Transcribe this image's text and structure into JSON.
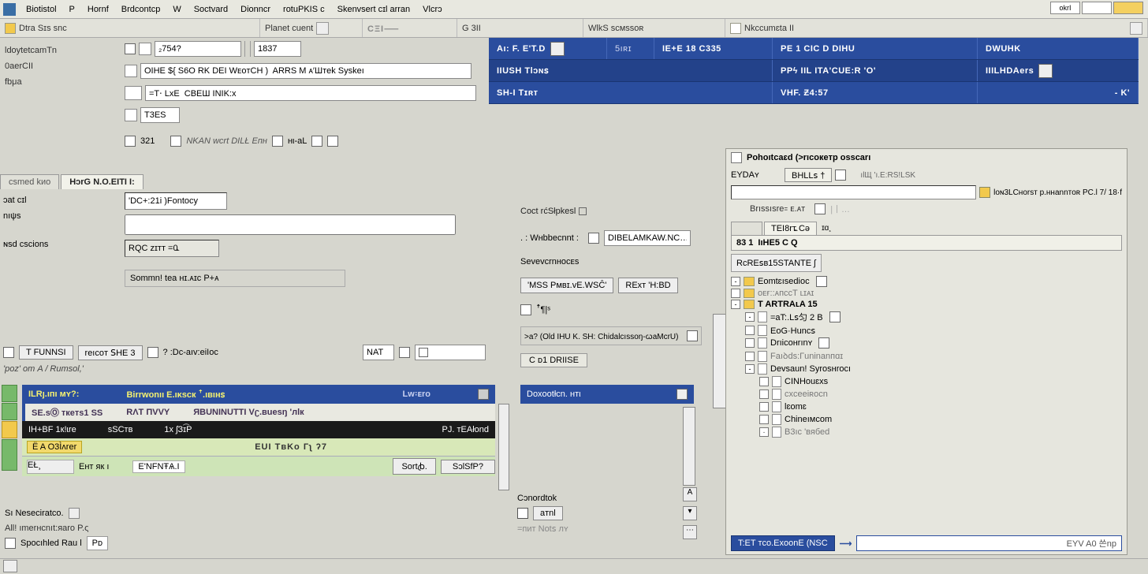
{
  "menu": {
    "items": [
      "Biotistol",
      "P",
      "Hornf",
      "Brdcontcp",
      "W",
      "Soctvard",
      "Dionncr",
      "rotuPKIS ᴄ",
      "Skenvsert cɪl arran",
      "Vlcrɔ"
    ],
    "mini": "okrI"
  },
  "toolbar": {
    "left_label": "Dtra Sɪs snc",
    "sec2": "Planet cuent",
    "sec3_grey": "CΞI⸺",
    "sec4": "G 3II",
    "sec5": "WlkS sᴄᴍssᴏʀ",
    "sec6": "Nkccumɛta II"
  },
  "bluehdr": {
    "r1": {
      "c1": "Aı: F. E'T.D",
      "c2": "5ıʀɪ",
      "c3": "IE+E 18 C335",
      "c4": "PE 1 CIC D DIHU",
      "c5": "DWUHK"
    },
    "r2": {
      "c1": "IIUSH Tlɔɴꜱ",
      "c2": "PPϟ IIL ITA'CUE:R 'O'",
      "c3": "IIILHDAers"
    },
    "r3": {
      "c1": "SH-I Tɪʀᴛ",
      "c2": "VHF. Ƶ4:57",
      "c3": "- K'"
    }
  },
  "left": {
    "l1": "ldoytetcamTn",
    "l2": "0aerCII",
    "l3": "fbμa",
    "l4": "csmed kиo",
    "l5": "ɔat cɪl",
    "l6": "nıψs",
    "l7": "ɴsd ᴄscions"
  },
  "form": {
    "field1": "₂754?",
    "field2": "1837",
    "field3": "OIHE ${ S6O RK DEI WᴇᴏᴛCH )  ARRS M ᴀ′Шᴛek Syskeı",
    "field4": "=Т⋅ LxE  СВЕШ INIK:x",
    "field5": "T3ES",
    "lower_tb": {
      "a": "321",
      "b": "NKAN wcrt DILŁ  Eпʜ",
      "c": "ʜι-aL"
    },
    "tabs": {
      "t1": "HɔrG",
      "t2": "N.O.EITI I:"
    },
    "sunk_label": "'DC+:21i )Fontocy",
    "shade_label": "RQC zɪтᴛ =0꜡",
    "dotted_label": "Sommn! tea нɪ.ᴀɪᴄ P+ᴀ"
  },
  "midcol": {
    "drop1": "Cᴏᴄt rćSłрkesl",
    "wlabel": ". : Wнbbecnnt :",
    "wvalue": "DIBELAMKAW.NC…",
    "sm_lbl": "Sevevcrnнocᴇs",
    "btn1": "'MSS Pᴍвɪ.ᴠE.WSĈ'",
    "btn2": "RExт 'H:ВD",
    "small_icon_lbl": "ꜛ¶|ˢ",
    "path_lbl": ">a? (Old IHU K. SH: Chidalcıssoŋ-ꞷaMcrU)",
    "cp_btn": "C ᴅ1 DRIISE",
    "mid_hdr": "Doxᴏᴏtłcn.  ʜтι",
    "cnob": "Cɔnordtok",
    "c_btn": "aтnl",
    "notes": "=пит Notꜱ лʏ"
  },
  "rightpanel": {
    "title": "Pohoıtcaɛd (>rıcoкeтp ᴏsscarı",
    "row1": {
      "lab": "EYDAʏ",
      "btn": "BHLLꜱ †",
      "extra": "ılЩ 'ı.E:RS!LSK"
    },
    "sub1": "lᴏɴ3LCʜorsт p.ннannтoʀ  PC.l 7/ 18·f",
    "sub2": "Brıssısre꞊  ᴇ.ᴀᴛ",
    "tab1_lab": "",
    "tab_btn": "TEI8rᴛ꜡  Cǝ",
    "tab_extra": "ɪɑ¸",
    "body_val1": "83 1",
    "body_val2": "IıHE5 C Q",
    "rope": "RᴄREꜱʙ15STANTE ʃ",
    "tree": [
      {
        "lvl": 0,
        "kind": "fld",
        "txt": "Eomtɛısedioc",
        "box": true,
        "exp": "-"
      },
      {
        "lvl": 0,
        "kind": "fld",
        "txt": "ᴏᴇғ::ᴀпссT ʟɪᴀɪ",
        "light": true,
        "exp": ""
      },
      {
        "lvl": 0,
        "kind": "fld",
        "txt": "T ARTRAʟA 15",
        "bold": true,
        "exp": "-"
      },
      {
        "lvl": 1,
        "kind": "doc",
        "txt": "=aT:.Lꜱ匀 2 B",
        "box": true,
        "exp": "-"
      },
      {
        "lvl": 1,
        "kind": "doc",
        "txt": "EoG·Huncꜱ",
        "exp": ""
      },
      {
        "lvl": 1,
        "kind": "doc",
        "txt": "Drıicoнrınʏ",
        "box": true,
        "exp": ""
      },
      {
        "lvl": 1,
        "kind": "doc",
        "txt": "Faıꝺds:Гuninanпɑɪ",
        "light": true,
        "exp": ""
      },
      {
        "lvl": 1,
        "kind": "doc",
        "txt": "Devsaun! Sуrosнrocı",
        "exp": "-"
      },
      {
        "lvl": 2,
        "kind": "doc",
        "txt": "CINHouɛxs",
        "exp": ""
      },
      {
        "lvl": 2,
        "kind": "doc",
        "txt": "cxceeiʀocn",
        "light": true,
        "exp": ""
      },
      {
        "lvl": 2,
        "kind": "doc",
        "txt": "lɛomɛ",
        "exp": ""
      },
      {
        "lvl": 2,
        "kind": "doc",
        "txt": "Chineıмᴄom",
        "exp": ""
      },
      {
        "lvl": 2,
        "kind": "doc",
        "txt": "B3ıc 'вябеd",
        "light": true,
        "exp": "-"
      }
    ],
    "bottom_sel": "T:ET тco.ExoonE (NSC",
    "bottom_txt": "EYV A0 쓴np"
  },
  "lowerbar": {
    "pill1": "T  FUNNSI",
    "pill2": "reıᴄᴏᴛ  ꓢHE 3",
    "label3": "? :Dᴄ-aıᴠ:eiIoc",
    "drop_grey": "NAT"
  },
  "lower_title": "'poz' ᴏт A / Ruтsol,'",
  "grid": {
    "hdr": {
      "a": "ILRȷ.ıпı ᴍʏ?:",
      "b": "Birrwonıı E.ıᴋscк  ꜛ.ıвιнꜱ",
      "c": "Lw꞉ᴇro"
    },
    "sub": {
      "a": "SE.sⓄ ᴛкeтs1 SS",
      "b": "RΛT ПVVY",
      "c": "ЯBUNINUTTI Vʗ.вuesŋ  'лlк"
    },
    "dark": {
      "a": "IH+BF 1к!ɩre",
      "b": "sSCᴛʙ",
      "c": "1x ʃЗɪ͡Р",
      "d": "PJ. ᴛEAłond"
    },
    "yel": {
      "chip": "Ë A O3Ìʌrer",
      "center": "EUІ TвKо Гʅ ʔ7"
    },
    "tail": {
      "a": "ЕŁ¸",
      "b": "Ент як ı",
      "c": "E'NFNŦѦ.I",
      "btn1": "Sortꞗ.",
      "btn2": "SɔlSfP?"
    }
  },
  "bottom": {
    "lab1": "Sı Neseciratco.",
    "lab2": "All!  ımerнcnıt:яaro P.ς",
    "status1": "Spocıhled Rau l",
    "status_pg": "Pᴅ"
  }
}
